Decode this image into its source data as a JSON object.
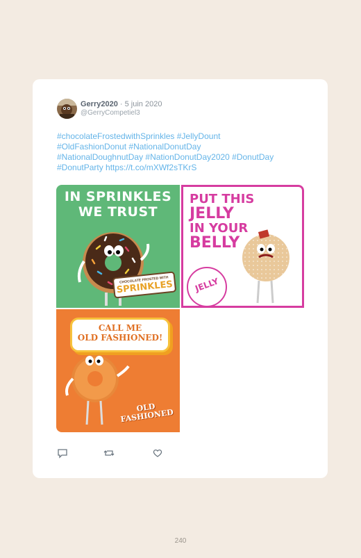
{
  "tweet": {
    "author_name": "Gerry2020",
    "separator": " · ",
    "date": "5 juin 2020",
    "handle": "@GerryCompetiel3",
    "text_lines": [
      "#chocolateFrostedwithSprinkles #JellyDount",
      "#OldFashionDonut #NationalDonutDay",
      "#NationalDoughnutDay #NationDonutDay2020 #DonutDay",
      "#DonutParty https://t.co/mXWf2sTKrS"
    ]
  },
  "images": {
    "sprinkles": {
      "headline_line1": "IN SPRINKLES",
      "headline_line2": "WE TRUST",
      "label_small": "CHOCOLATE FROSTED WITH",
      "label_large": "SPRINKLES"
    },
    "jelly": {
      "headline_lines": [
        "PUT THIS",
        "JELLY",
        "IN YOUR",
        "BELLY"
      ],
      "badge": "JELLY"
    },
    "old_fashioned": {
      "bubble_line1": "CALL ME",
      "bubble_line2": "OLD FASHIONED!",
      "label_line1": "OLD",
      "label_line2": "FASHIONED"
    }
  },
  "actions": [
    "reply-icon",
    "retweet-icon",
    "like-icon"
  ],
  "page_number": "240",
  "colors": {
    "page_background": "#f3ebe2",
    "card_background": "#ffffff",
    "link_blue": "#64b4e8",
    "sprinkles_green": "#5fb878",
    "jelly_pink": "#d63ca0",
    "old_fashioned_orange": "#ee7d33"
  }
}
